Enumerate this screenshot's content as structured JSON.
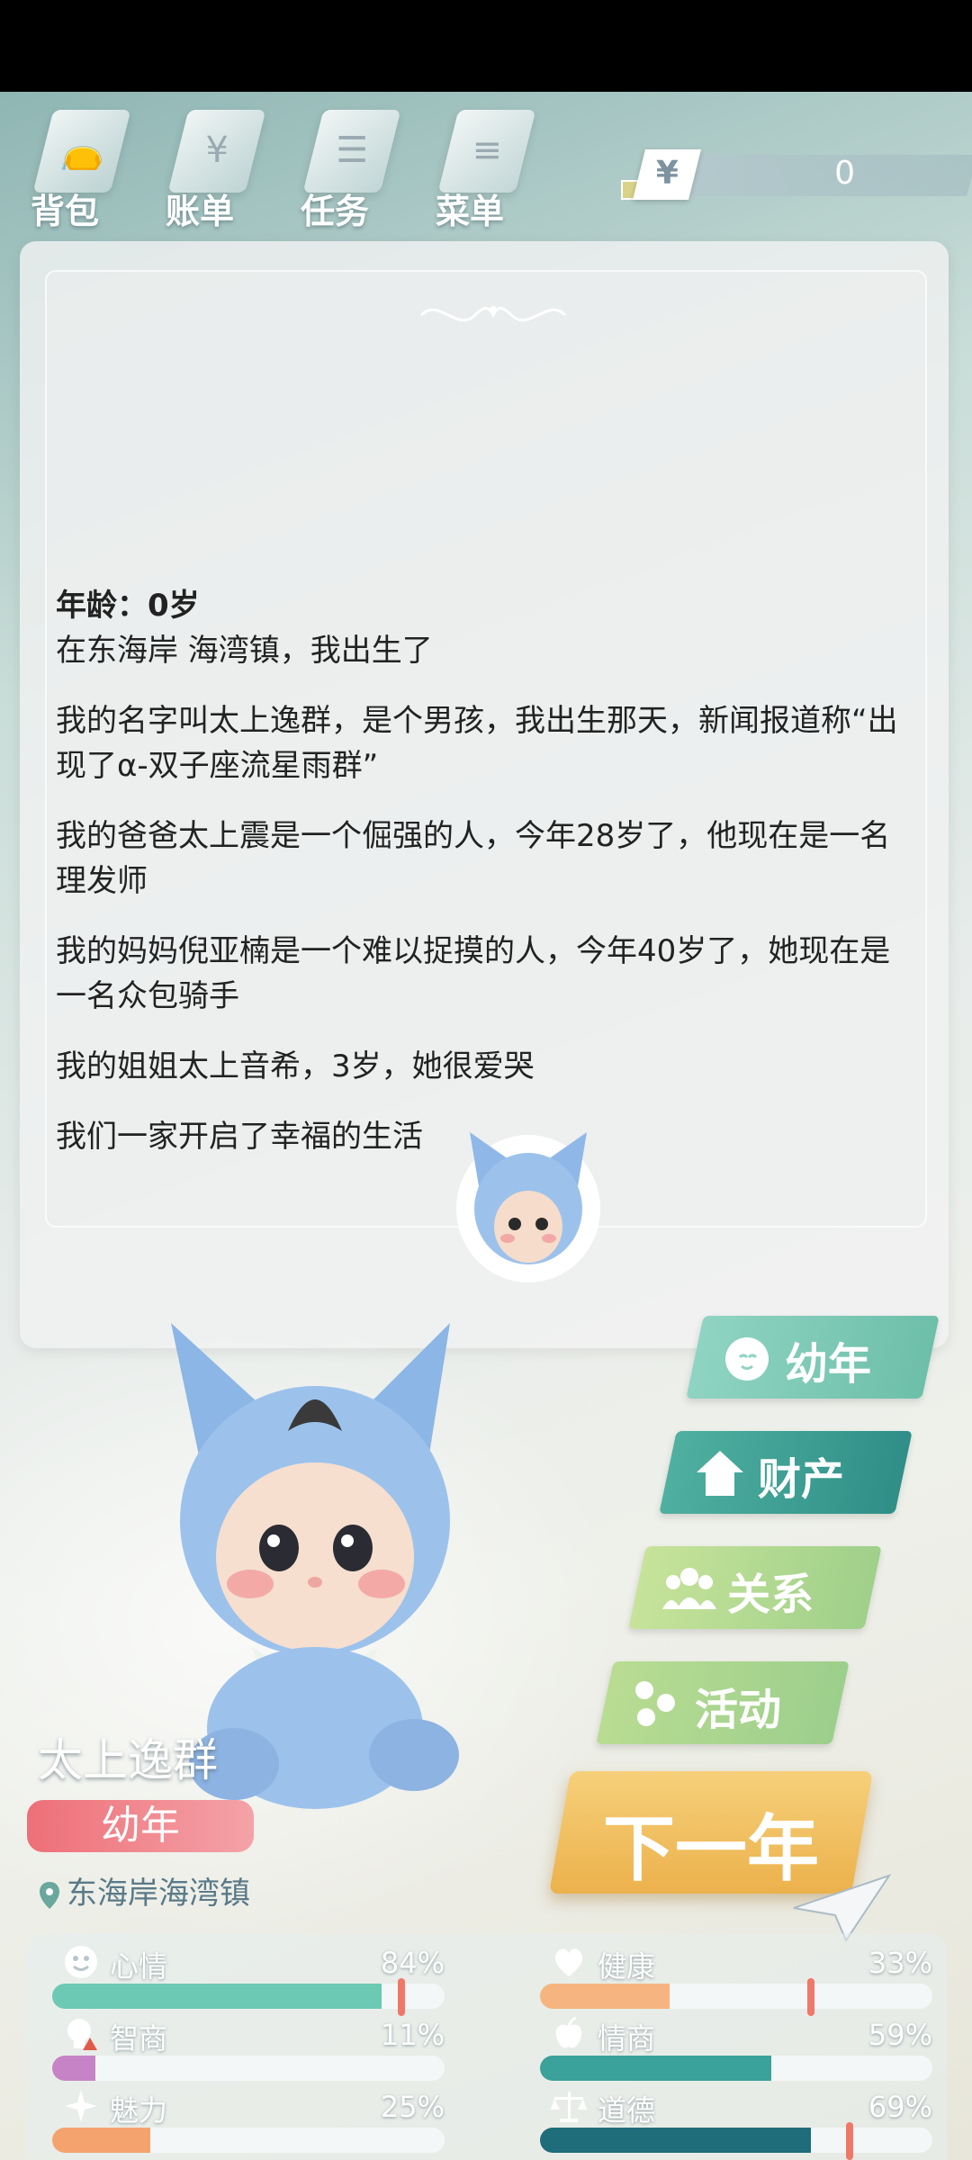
{
  "topnav": {
    "items": [
      {
        "label": "背包",
        "icon": "bag-icon"
      },
      {
        "label": "账单",
        "icon": "bill-icon"
      },
      {
        "label": "任务",
        "icon": "task-list-icon"
      },
      {
        "label": "菜单",
        "icon": "menu-icon"
      }
    ],
    "money": {
      "symbol": "¥",
      "value": "0"
    }
  },
  "story": {
    "age": "年龄：0岁",
    "paragraphs": [
      "在东海岸 海湾镇，我出生了",
      "我的名字叫太上逸群，是个男孩，我出生那天，新闻报道称“出现了α-双子座流星雨群”",
      "我的爸爸太上震是一个倔强的人，今年28岁了，他现在是一名理发师",
      "我的妈妈倪亚楠是一个难以捉摸的人，今年40岁了，她现在是一名众包骑手",
      "我的姐姐太上音希，3岁，她很爱哭",
      "我们一家开启了幸福的生活"
    ]
  },
  "side_buttons": [
    {
      "label": "幼年",
      "icon": "baby-face-icon",
      "color": "#7fcab6"
    },
    {
      "label": "财产",
      "icon": "house-icon",
      "color": "#3fa597"
    },
    {
      "label": "关系",
      "icon": "people-icon",
      "color": "#b6d98f"
    },
    {
      "label": "活动",
      "icon": "activity-dots-icon",
      "color": "#a9d28e"
    }
  ],
  "character": {
    "name": "太上逸群",
    "stage": "幼年",
    "location": "东海岸海湾镇"
  },
  "next_year": {
    "label": "下一年"
  },
  "stats": [
    {
      "label": "心情",
      "percent": "84%",
      "value": 0.84,
      "color": "#6cc9b4",
      "icon": "smiley-icon",
      "marker": 0.89
    },
    {
      "label": "健康",
      "percent": "33%",
      "value": 0.33,
      "color": "#f6b580",
      "icon": "heart-icon",
      "marker": 0.69
    },
    {
      "label": "智商",
      "percent": "11%",
      "value": 0.11,
      "color": "#c683c5",
      "icon": "lightbulb-warning-icon",
      "marker": null
    },
    {
      "label": "情商",
      "percent": "59%",
      "value": 0.59,
      "color": "#3aa29a",
      "icon": "apple-icon",
      "marker": null
    },
    {
      "label": "魅力",
      "percent": "25%",
      "value": 0.25,
      "color": "#f5a36e",
      "icon": "sparkle-icon",
      "marker": null
    },
    {
      "label": "道德",
      "percent": "69%",
      "value": 0.69,
      "color": "#1f6c7a",
      "icon": "scales-icon",
      "marker": 0.79
    }
  ]
}
